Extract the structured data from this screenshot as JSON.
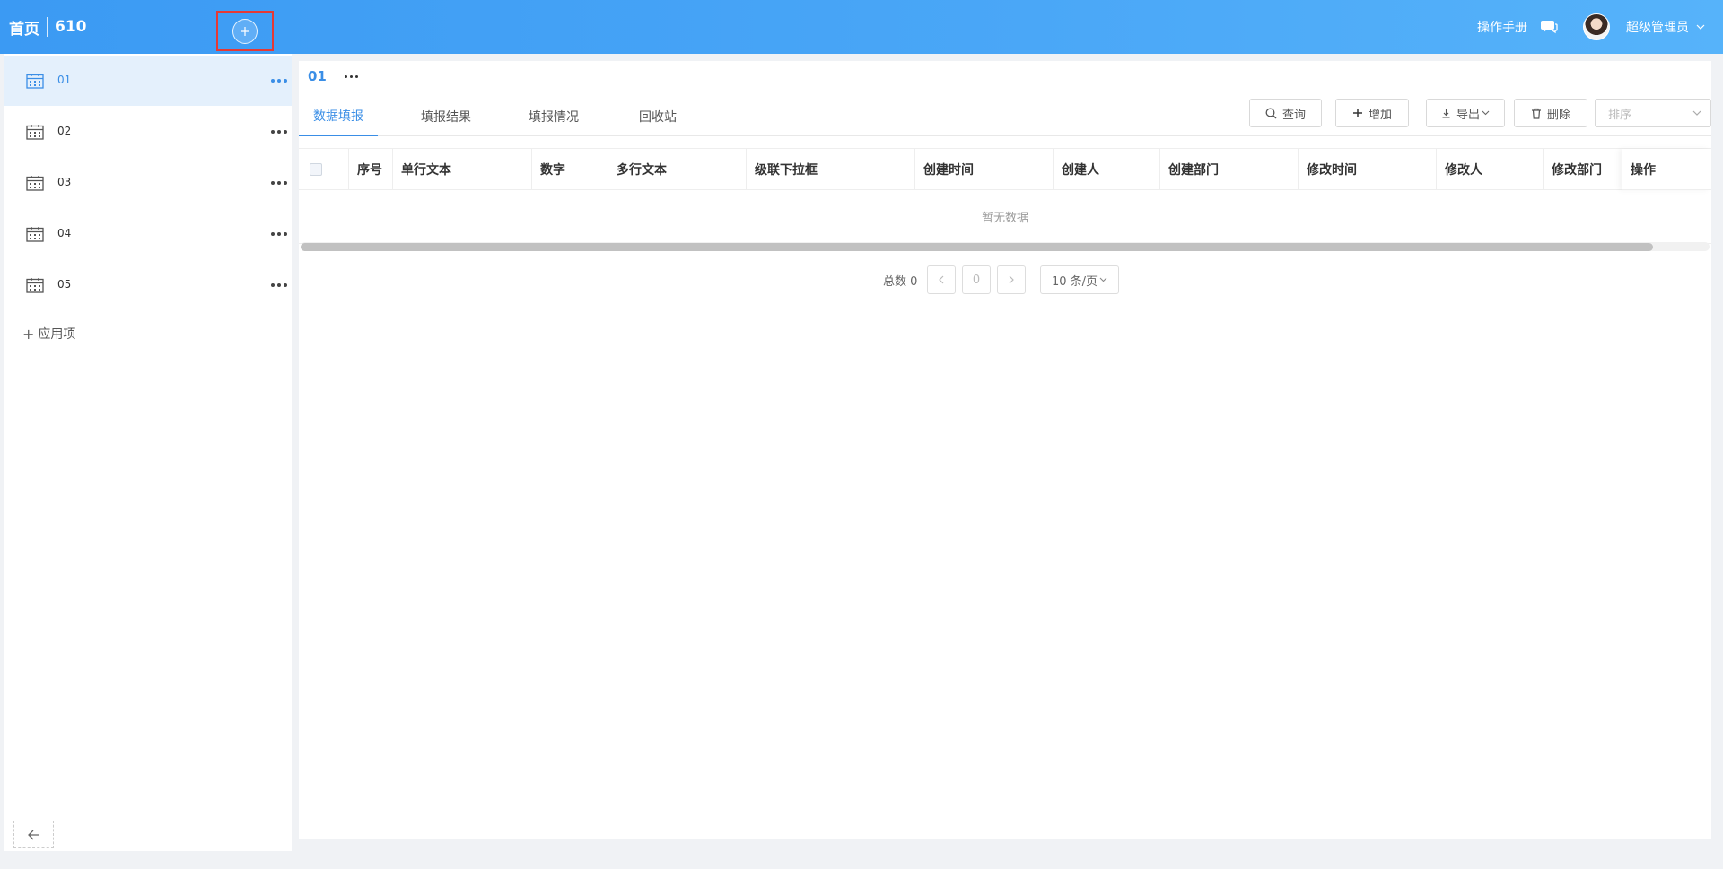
{
  "header": {
    "home": "首页",
    "app_name": "610",
    "manual": "操作手册",
    "user": "超级管理员"
  },
  "sidebar": {
    "items": [
      {
        "label": "01"
      },
      {
        "label": "02"
      },
      {
        "label": "03"
      },
      {
        "label": "04"
      },
      {
        "label": "05"
      }
    ],
    "add_item": "应用项"
  },
  "main": {
    "title": "01",
    "tabs": [
      {
        "label": "数据填报"
      },
      {
        "label": "填报结果"
      },
      {
        "label": "填报情况"
      },
      {
        "label": "回收站"
      }
    ],
    "buttons": {
      "query": "查询",
      "add": "增加",
      "export": "导出",
      "delete": "删除"
    },
    "sort_placeholder": "排序",
    "table": {
      "columns": [
        "序号",
        "单行文本",
        "数字",
        "多行文本",
        "级联下拉框",
        "创建时间",
        "创建人",
        "创建部门",
        "修改时间",
        "修改人",
        "修改部门",
        "操作"
      ],
      "empty_text": "暂无数据"
    },
    "pagination": {
      "total": "总数 0",
      "current_page": "0",
      "page_size": "10 条/页"
    }
  }
}
